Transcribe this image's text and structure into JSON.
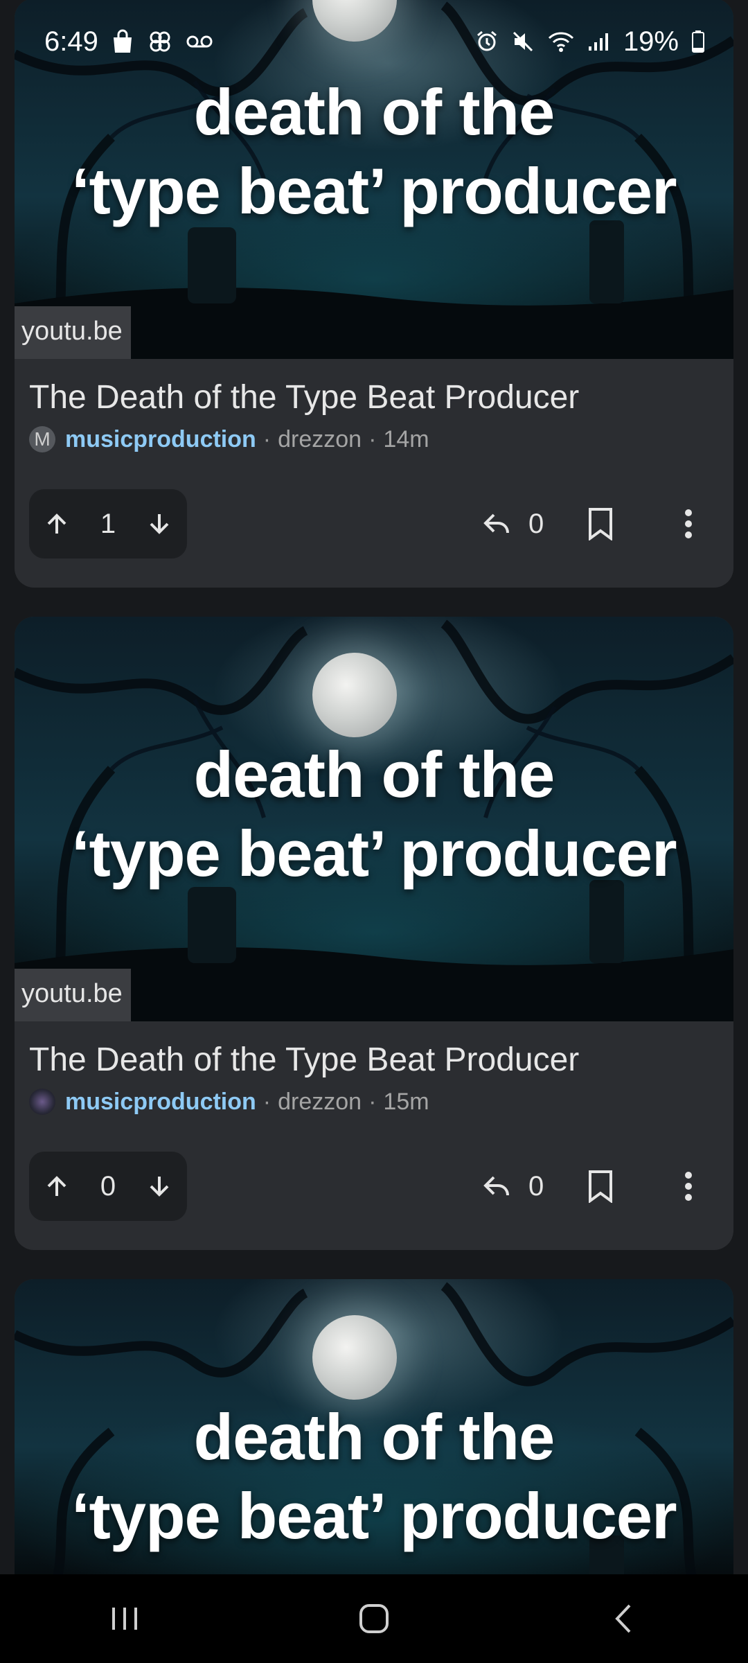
{
  "status_bar": {
    "time": "6:49",
    "battery": "19%",
    "left_icons": [
      "shopping-bag-icon",
      "pinwheel-icon",
      "voicemail-icon"
    ],
    "right_icons": [
      "alarm-icon",
      "mute-icon",
      "wifi-icon",
      "signal-icon",
      "battery-icon"
    ]
  },
  "posts": [
    {
      "thumbnail_text_line1": "death of the",
      "thumbnail_text_line2": "‘type beat’ producer",
      "domain": "youtu.be",
      "title": "The Death of the Type Beat Producer",
      "avatar_letter": "M",
      "community": "musicproduction",
      "author": "drezzon",
      "time": "14m",
      "score": "1",
      "replies": "0"
    },
    {
      "thumbnail_text_line1": "death of the",
      "thumbnail_text_line2": "‘type beat’ producer",
      "domain": "youtu.be",
      "title": "The Death of the Type Beat Producer",
      "avatar_letter": "",
      "community": "musicproduction",
      "author": "drezzon",
      "time": "15m",
      "score": "0",
      "replies": "0"
    },
    {
      "thumbnail_text_line1": "death of the",
      "thumbnail_text_line2": "‘type beat’ producer"
    }
  ],
  "colors": {
    "background": "#17191c",
    "card": "#2b2d31",
    "community_link": "#8ecaf5",
    "nav_bar": "#000000"
  }
}
